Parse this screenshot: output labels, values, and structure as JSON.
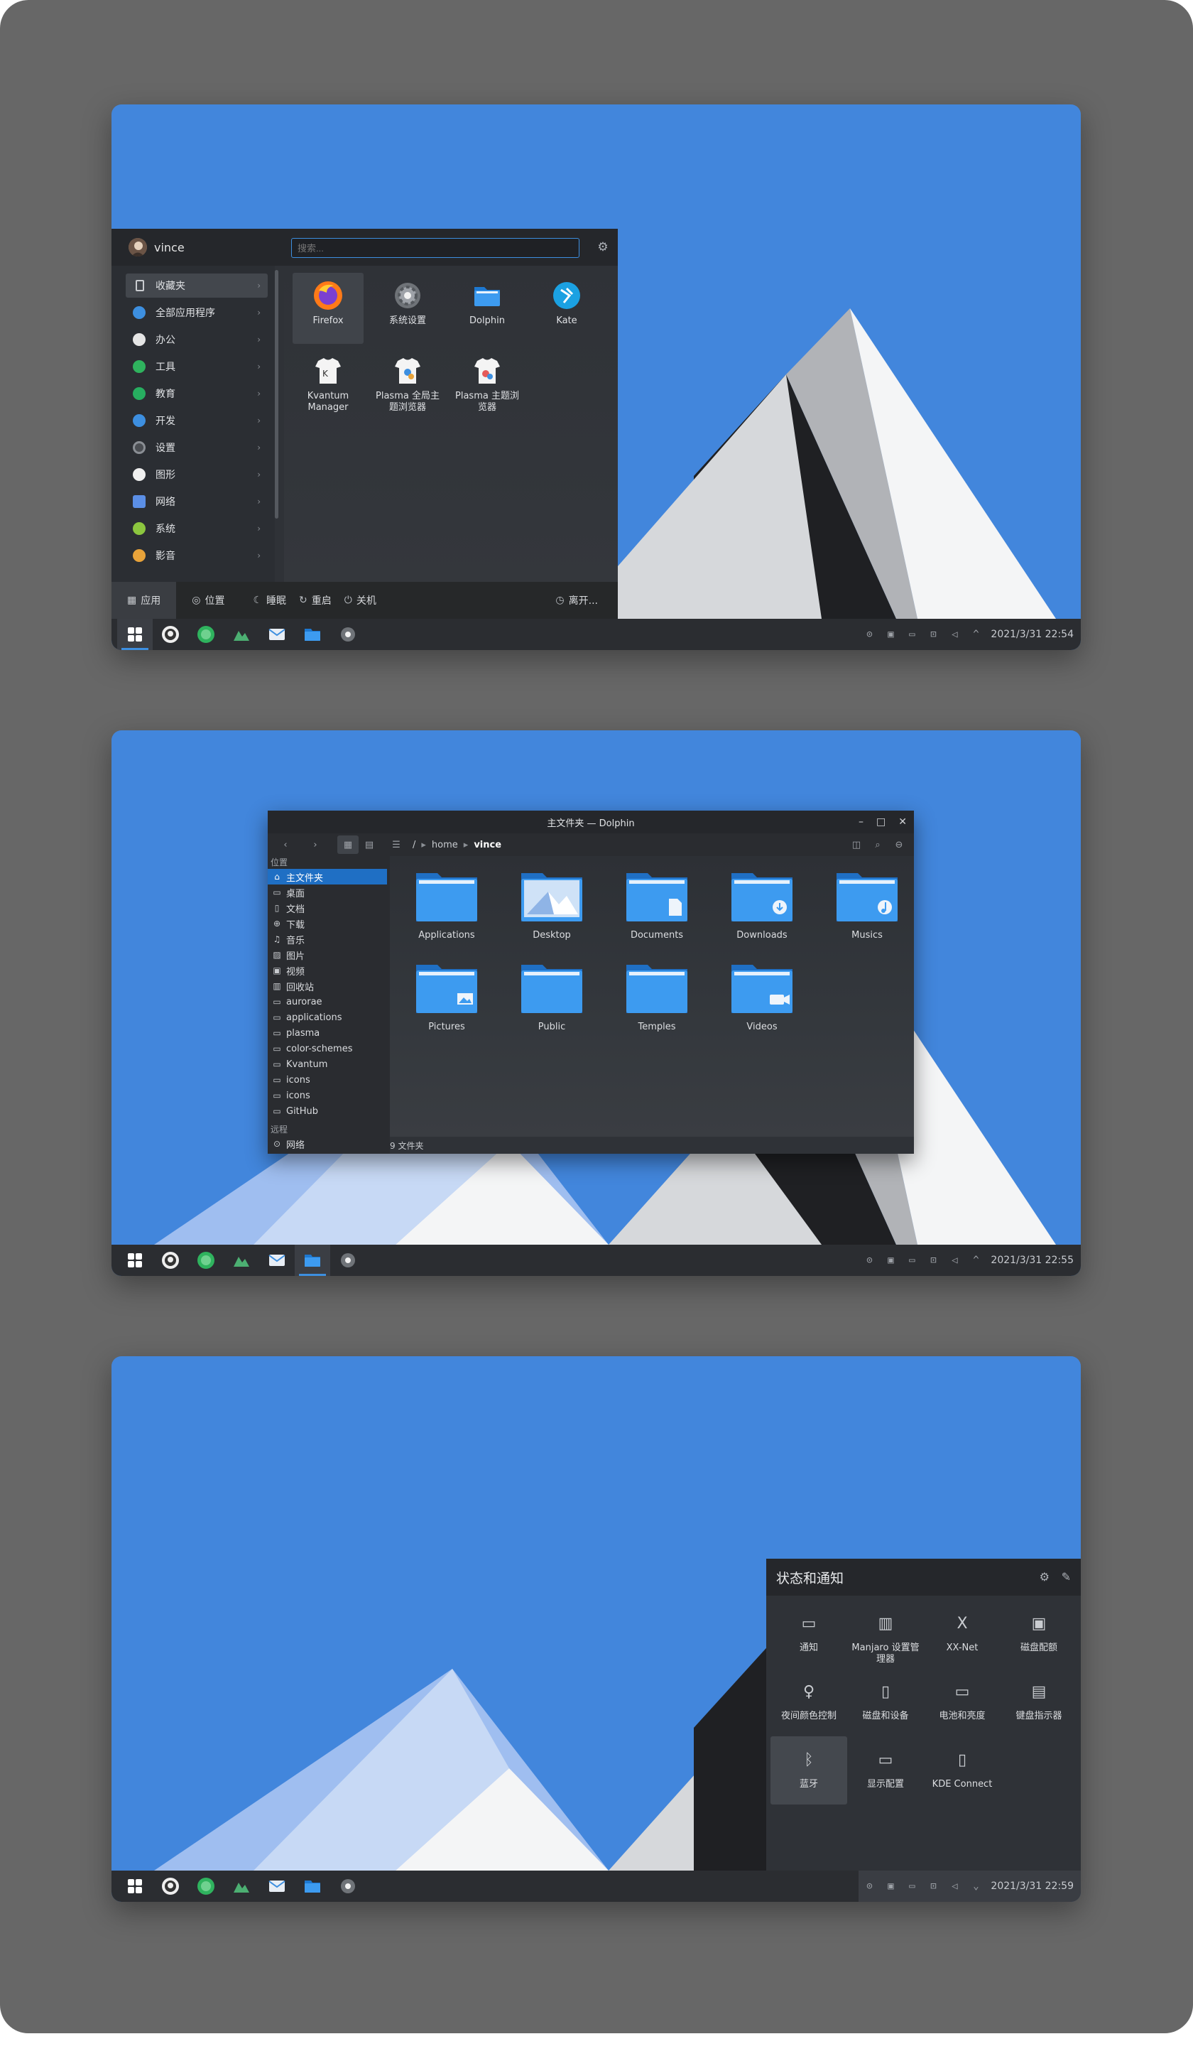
{
  "colors": {
    "wallpaper_blue": "#4286dc",
    "panel_dark": "#2b2d31",
    "accent": "#3d8fe0"
  },
  "taskbar": {
    "apps": [
      "app-launcher-icon",
      "github-icon",
      "green-app-icon",
      "scenery-icon",
      "mail-icon",
      "dolphin-icon",
      "settings-icon"
    ],
    "tray": [
      "sync-icon",
      "notes-icon",
      "keyboard-icon",
      "network-icon",
      "volume-icon"
    ]
  },
  "shot1": {
    "clock": "2021/3/31 22:54",
    "kickoff": {
      "user": "vince",
      "search_placeholder": "搜索...",
      "categories": [
        {
          "label": "收藏夹",
          "icon": "bookmark-icon",
          "color": "#3d8fe0"
        },
        {
          "label": "全部应用程序",
          "icon": "grid-icon",
          "color": "#3d8fe0"
        },
        {
          "label": "办公",
          "icon": "office-icon",
          "color": "#e5e5e5"
        },
        {
          "label": "工具",
          "icon": "tools-icon",
          "color": "#2fb35e"
        },
        {
          "label": "教育",
          "icon": "education-icon",
          "color": "#27ae60"
        },
        {
          "label": "开发",
          "icon": "development-icon",
          "color": "#3d8fe0"
        },
        {
          "label": "设置",
          "icon": "settings-icon",
          "color": "#8a8e94"
        },
        {
          "label": "图形",
          "icon": "graphics-icon",
          "color": "#f0f0f0"
        },
        {
          "label": "网络",
          "icon": "network-icon",
          "color": "#5b8fe6"
        },
        {
          "label": "系统",
          "icon": "system-icon",
          "color": "#8cc63f"
        },
        {
          "label": "影音",
          "icon": "multimedia-icon",
          "color": "#e8a33a"
        }
      ],
      "apps": [
        {
          "label": "Firefox",
          "icon": "firefox-icon"
        },
        {
          "label": "系统设置",
          "icon": "system-settings-icon"
        },
        {
          "label": "Dolphin",
          "icon": "dolphin-folder-icon"
        },
        {
          "label": "Kate",
          "icon": "kate-icon"
        },
        {
          "label": "Kvantum Manager",
          "icon": "kvantum-icon"
        },
        {
          "label": "Plasma 全局主题浏览器",
          "icon": "plasma-shirt-icon"
        },
        {
          "label": "Plasma 主题浏览器",
          "icon": "plasma-shirt-icon-2"
        }
      ],
      "footer": {
        "tab_apps": "应用",
        "tab_places": "位置",
        "sleep": "睡眠",
        "restart": "重启",
        "shutdown": "关机",
        "leave": "离开..."
      }
    }
  },
  "shot2": {
    "clock": "2021/3/31 22:55",
    "dolphin": {
      "title": "主文件夹 — Dolphin",
      "breadcrumb": [
        "/",
        "home",
        "vince"
      ],
      "places_header": "位置",
      "places": [
        {
          "label": "主文件夹",
          "icon": "home-icon"
        },
        {
          "label": "桌面",
          "icon": "desktop-icon"
        },
        {
          "label": "文档",
          "icon": "documents-icon"
        },
        {
          "label": "下载",
          "icon": "downloads-icon"
        },
        {
          "label": "音乐",
          "icon": "music-icon"
        },
        {
          "label": "图片",
          "icon": "pictures-icon"
        },
        {
          "label": "视频",
          "icon": "videos-icon"
        },
        {
          "label": "回收站",
          "icon": "trash-icon"
        },
        {
          "label": "aurorae",
          "icon": "folder-icon"
        },
        {
          "label": "applications",
          "icon": "folder-icon"
        },
        {
          "label": "plasma",
          "icon": "folder-icon"
        },
        {
          "label": "color-schemes",
          "icon": "folder-icon"
        },
        {
          "label": "Kvantum",
          "icon": "folder-icon"
        },
        {
          "label": "icons",
          "icon": "folder-icon"
        },
        {
          "label": "icons",
          "icon": "folder-icon"
        },
        {
          "label": "GitHub",
          "icon": "folder-icon"
        }
      ],
      "remote_header": "远程",
      "remote_item": "网络",
      "folders": [
        {
          "label": "Applications",
          "badge": "none"
        },
        {
          "label": "Desktop",
          "badge": "desktop"
        },
        {
          "label": "Documents",
          "badge": "document"
        },
        {
          "label": "Downloads",
          "badge": "download"
        },
        {
          "label": "Musics",
          "badge": "music"
        },
        {
          "label": "Pictures",
          "badge": "picture"
        },
        {
          "label": "Public",
          "badge": "none"
        },
        {
          "label": "Temples",
          "badge": "none"
        },
        {
          "label": "Videos",
          "badge": "video"
        }
      ],
      "status": "9 文件夹"
    }
  },
  "shot3": {
    "clock": "2021/3/31 22:59",
    "notifications": {
      "title": "状态和通知",
      "items": [
        {
          "label": "通知",
          "icon": "notification-icon"
        },
        {
          "label": "Manjaro 设置管理器",
          "icon": "manjaro-icon"
        },
        {
          "label": "XX-Net",
          "icon": "xxnet-icon"
        },
        {
          "label": "磁盘配额",
          "icon": "disk-quota-icon"
        },
        {
          "label": "夜间颜色控制",
          "icon": "night-color-icon"
        },
        {
          "label": "磁盘和设备",
          "icon": "devices-icon"
        },
        {
          "label": "电池和亮度",
          "icon": "battery-icon"
        },
        {
          "label": "键盘指示器",
          "icon": "keyboard-indicator-icon"
        },
        {
          "label": "蓝牙",
          "icon": "bluetooth-icon"
        },
        {
          "label": "显示配置",
          "icon": "display-icon"
        },
        {
          "label": "KDE Connect",
          "icon": "kdeconnect-icon"
        }
      ]
    }
  }
}
